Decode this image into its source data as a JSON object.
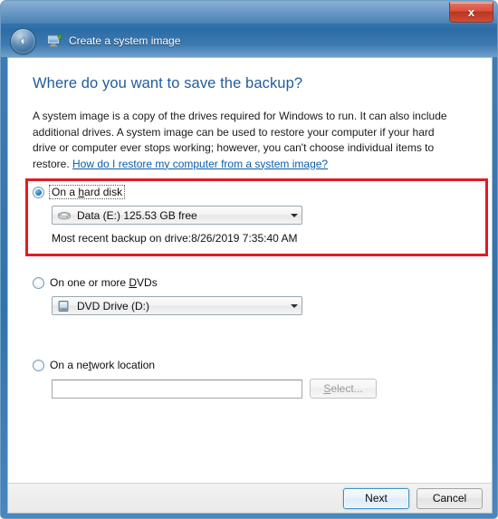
{
  "window": {
    "title": "Create a system image",
    "title_icon": "system-image-icon",
    "back_icon": "back-arrow-icon",
    "close_label": "x",
    "close_icon": "close-icon"
  },
  "page": {
    "heading": "Where do you want to save the backup?",
    "intro_text": "A system image is a copy of the drives required for Windows to run. It can also include additional drives. A system image can be used to restore your computer if your hard drive or computer ever stops working; however, you can't choose individual items to restore. ",
    "intro_link": "How do I restore my computer from a system image?"
  },
  "options": {
    "hard_disk": {
      "label_pre": "On a ",
      "label_mnemonic": "h",
      "label_post": "ard disk",
      "selected": true,
      "combo_value": "Data (E:)  125.53 GB free",
      "combo_icon": "hard-disk-icon",
      "note": "Most recent backup on drive:8/26/2019 7:35:40 AM"
    },
    "dvds": {
      "label_pre": "On one or more ",
      "label_mnemonic": "D",
      "label_post": "VDs",
      "selected": false,
      "combo_value": "DVD Drive (D:)",
      "combo_icon": "dvd-drive-icon"
    },
    "network": {
      "label_pre": "On a ne",
      "label_mnemonic": "t",
      "label_post": "work location",
      "selected": false,
      "input_value": "",
      "input_placeholder": "",
      "select_button_pre": "",
      "select_button_mnemonic": "S",
      "select_button_post": "elect...",
      "select_button_enabled": false
    }
  },
  "footer": {
    "next_label": "Next",
    "cancel_label": "Cancel"
  },
  "annotation": {
    "highlight_color": "#e01b24",
    "highlight_target": "on-a-hard-disk-option-group"
  },
  "colors": {
    "titlebar_blue": "#2f6fa8",
    "heading_blue": "#1f5c9e",
    "link_blue": "#0b5ca8",
    "close_red": "#cf4e38",
    "default_button_border": "#3c8fc4"
  }
}
